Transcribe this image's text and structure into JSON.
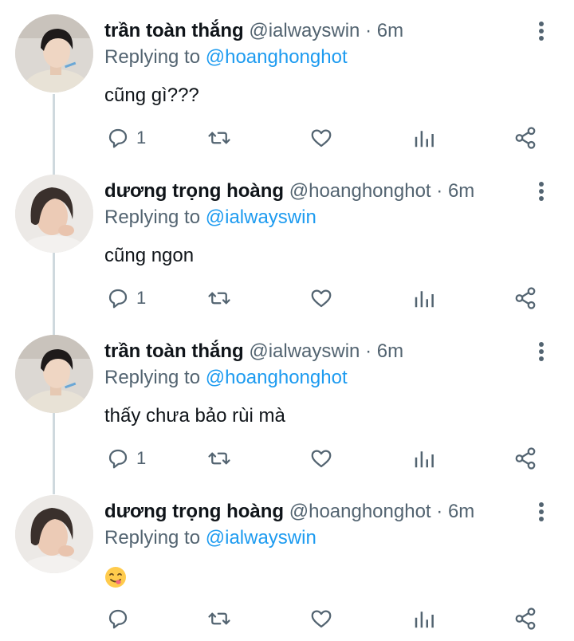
{
  "tweets": [
    {
      "name": "trần toàn thắng",
      "handle": "@ialwayswin",
      "separator": "·",
      "time": "6m",
      "replying_prefix": "Replying to",
      "replying_to": "@hoanghonghot",
      "text": "cũng gì???",
      "reply_count": "1",
      "avatar": "avatar-boy-icon"
    },
    {
      "name": "dương trọng hoàng",
      "handle": "@hoanghonghot",
      "separator": "·",
      "time": "6m",
      "replying_prefix": "Replying to",
      "replying_to": "@ialwayswin",
      "text": "cũng ngon",
      "reply_count": "1",
      "avatar": "avatar-longhair-icon"
    },
    {
      "name": "trần toàn thắng",
      "handle": "@ialwayswin",
      "separator": "·",
      "time": "6m",
      "replying_prefix": "Replying to",
      "replying_to": "@hoanghonghot",
      "text": "thấy chưa bảo rùi mà",
      "reply_count": "1",
      "avatar": "avatar-boy-icon"
    },
    {
      "name": "dương trọng hoàng",
      "handle": "@hoanghonghot",
      "separator": "·",
      "time": "6m",
      "replying_prefix": "Replying to",
      "replying_to": "@ialwayswin",
      "text": "",
      "emoji": "yum-face-emoji",
      "reply_count": "",
      "avatar": "avatar-longhair-icon"
    }
  ],
  "colors": {
    "text": "#0f1419",
    "secondary": "#536471",
    "link": "#1d9bf0",
    "thread_line": "#cfd9de"
  },
  "icons": [
    "reply-icon",
    "retweet-icon",
    "like-icon",
    "analytics-icon",
    "share-icon",
    "more-options-icon"
  ]
}
